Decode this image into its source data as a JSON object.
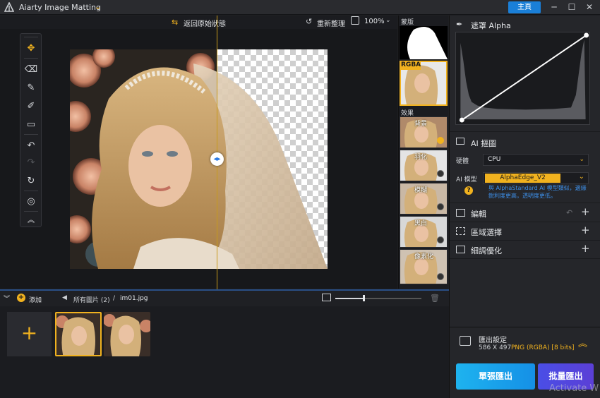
{
  "app": {
    "title": "Aiarty Image Matting",
    "home_label": "主頁"
  },
  "window": {
    "minimize": "─",
    "restore": "☐",
    "close": "✕"
  },
  "toolbar": {
    "revert_label": "返回原始狀態",
    "reorganize_label": "重新整理",
    "zoom_value": "100%"
  },
  "thumbs": {
    "mask_label": "蒙版",
    "rgba_label": "RGBA",
    "effects_label": "效果",
    "effects": [
      {
        "label": "背景",
        "selected": true
      },
      {
        "label": "羽化",
        "selected": false
      },
      {
        "label": "模糊",
        "selected": false
      },
      {
        "label": "黑白",
        "selected": false
      },
      {
        "label": "像素化",
        "selected": false
      }
    ]
  },
  "panel": {
    "alpha_title": "遮罩 Alpha",
    "ai_title": "AI 摳圖",
    "hardware_label": "硬體",
    "hardware_value": "CPU",
    "model_label": "AI 模型",
    "model_value": "AlphaEdge_V2",
    "model_note": "與 AlphaStandard AI 模型類似，邊緣銳利度更高，透明度更低。",
    "rows": [
      {
        "label": "編輯"
      },
      {
        "label": "區域選擇"
      },
      {
        "label": "細調優化"
      }
    ]
  },
  "export": {
    "title": "匯出設定",
    "size": "586 X 497",
    "format": "PNG (RGBA) [8 bits]",
    "single_label": "單張匯出",
    "batch_label": "批量匯出"
  },
  "watermark": "Activate W",
  "bottom": {
    "add_label": "添加",
    "all_images": "所有圖片 (2)",
    "separator": "/",
    "current_file": "im01.jpg",
    "zoom_fraction": 0.33
  },
  "colors": {
    "accent": "#f1b21f",
    "primary_blue": "#1a7fd8",
    "export_blue": "#1eb3ef",
    "batch_purple": "#5b3fd6"
  },
  "icons": [
    "app-logo-icon",
    "move-icon",
    "eraser-icon",
    "brush-icon",
    "paint-icon",
    "roller-icon",
    "undo-icon",
    "redo-icon",
    "reset-icon",
    "fit-icon",
    "collapse-icon",
    "refresh-icon",
    "zoom-icon",
    "split-handle-icon",
    "dropper-icon",
    "help-icon",
    "plus-icon",
    "trash-icon",
    "export-icon",
    "chevron-up-icon"
  ]
}
